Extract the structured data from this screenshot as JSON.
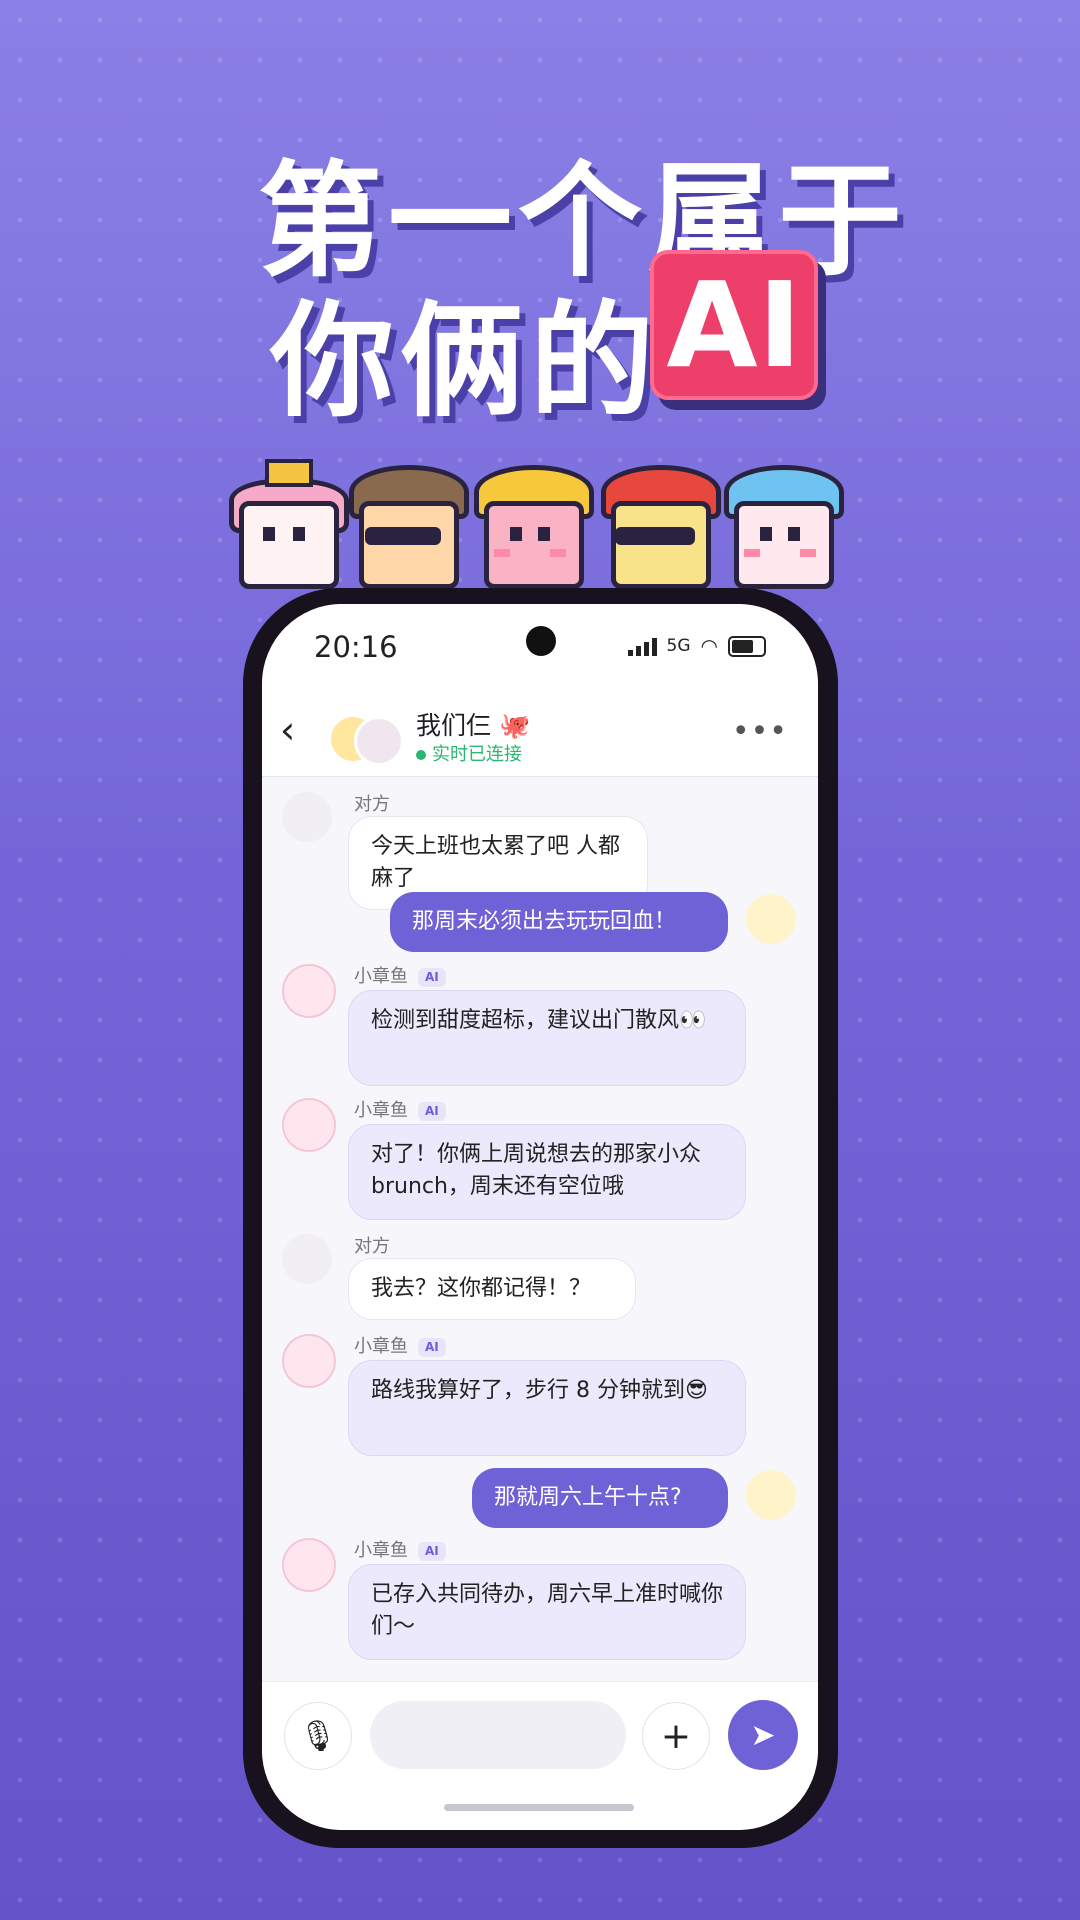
{
  "headline": {
    "line1": "第一个属于",
    "line2": "你俩的",
    "badge": "AI"
  },
  "status": {
    "time": "20:16",
    "network": "5G"
  },
  "chat": {
    "title": "我们仨 🐙",
    "online": "实时已连接",
    "more": "•••"
  },
  "messages": [
    {
      "side": "left",
      "sender": "对方",
      "text": "今天上班也太累了吧 人都麻了"
    },
    {
      "side": "right",
      "text": "那周末必须出去玩玩回血！"
    },
    {
      "side": "left",
      "sender": "小章鱼",
      "ai": true,
      "tag": "AI",
      "text": "检测到甜度超标，建议出门散风👀"
    },
    {
      "side": "left",
      "sender": "小章鱼",
      "ai": true,
      "tag": "AI",
      "text": "对了！你俩上周说想去的那家小众 brunch，周末还有空位哦"
    },
    {
      "side": "left",
      "sender": "对方",
      "text": "我去？这你都记得！？"
    },
    {
      "side": "left",
      "sender": "小章鱼",
      "ai": true,
      "tag": "AI",
      "text": "路线我算好了，步行 8 分钟就到😎"
    },
    {
      "side": "right",
      "text": "那就周六上午十点?"
    },
    {
      "side": "left",
      "sender": "小章鱼",
      "ai": true,
      "tag": "AI",
      "text": "已存入共同待办，周六早上准时喊你们～"
    }
  ],
  "composer": {
    "mic_icon": "🎙",
    "plus_icon": "+",
    "send_icon": "➤"
  },
  "icons": {
    "back": "chevron-left-icon"
  },
  "colors": {
    "accent": "#6f62d6",
    "badge": "#ee3f6b",
    "online": "#2bb673"
  }
}
